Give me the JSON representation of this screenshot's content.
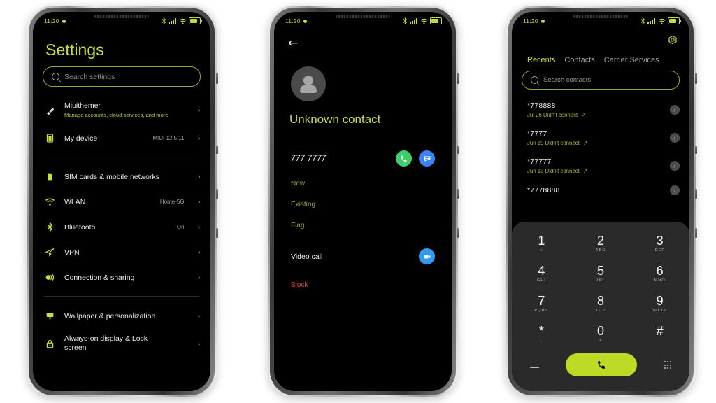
{
  "status_bar": {
    "time": "11:20",
    "icons": [
      "bluetooth-icon",
      "signal-icon",
      "wifi-icon",
      "battery-icon"
    ],
    "accent": "#c9d83a"
  },
  "settings_phone": {
    "title": "Settings",
    "search_placeholder": "Search settings",
    "groups": [
      {
        "items": [
          {
            "label": "Miuithemer",
            "subtitle": "Manage accounts, cloud services, and more",
            "value": "",
            "icon": "brush-icon"
          },
          {
            "label": "My device",
            "subtitle": "",
            "value": "MIUI 12.5.11",
            "icon": "device-icon"
          }
        ]
      },
      {
        "items": [
          {
            "label": "SIM cards & mobile networks",
            "subtitle": "",
            "value": "",
            "icon": "sim-card-icon"
          },
          {
            "label": "WLAN",
            "subtitle": "",
            "value": "Home-5G",
            "icon": "wifi-icon"
          },
          {
            "label": "Bluetooth",
            "subtitle": "",
            "value": "On",
            "icon": "bluetooth-icon"
          },
          {
            "label": "VPN",
            "subtitle": "",
            "value": "",
            "icon": "vpn-icon"
          },
          {
            "label": "Connection & sharing",
            "subtitle": "",
            "value": "",
            "icon": "connection-sharing-icon"
          }
        ]
      },
      {
        "items": [
          {
            "label": "Wallpaper & personalization",
            "subtitle": "",
            "value": "",
            "icon": "wallpaper-icon"
          },
          {
            "label": "Always-on display & Lock screen",
            "subtitle": "",
            "value": "",
            "icon": "lock-icon"
          }
        ]
      }
    ]
  },
  "contact_phone": {
    "back_icon": "back-arrow-icon",
    "avatar_icon": "person-avatar-icon",
    "name": "Unknown contact",
    "phone_number": "777 7777",
    "call_icon": "phone-call-icon",
    "message_icon": "message-icon",
    "actions": [
      "New",
      "Existing",
      "Flag"
    ],
    "video_call_label": "Video call",
    "video_icon": "video-camera-icon",
    "block_label": "Block",
    "colors": {
      "call": "#3ecf6a",
      "message": "#3b82f6",
      "video": "#2f9bf0",
      "block": "#e04b4b"
    }
  },
  "dialer_phone": {
    "settings_icon": "gear-icon",
    "tabs": [
      {
        "label": "Recents",
        "active": true
      },
      {
        "label": "Contacts",
        "active": false
      },
      {
        "label": "Carrier Services",
        "active": false
      }
    ],
    "search_placeholder": "Search contacts",
    "call_log": [
      {
        "number": "*778888",
        "detail": "Jul 26 Didn't connect",
        "direction_icon": "outgoing-call-icon"
      },
      {
        "number": "*7777",
        "detail": "Jun 19 Didn't connect",
        "direction_icon": "outgoing-call-icon"
      },
      {
        "number": "*77777",
        "detail": "Jun 13 Didn't connect",
        "direction_icon": "outgoing-call-icon"
      },
      {
        "number": "*7778888",
        "detail": "",
        "direction_icon": "outgoing-call-icon"
      }
    ],
    "keypad": [
      {
        "digit": "1",
        "sub": "∞"
      },
      {
        "digit": "2",
        "sub": "ABC"
      },
      {
        "digit": "3",
        "sub": "DEF"
      },
      {
        "digit": "4",
        "sub": "GHI"
      },
      {
        "digit": "5",
        "sub": "JKL"
      },
      {
        "digit": "6",
        "sub": "MNO"
      },
      {
        "digit": "7",
        "sub": "PQRS"
      },
      {
        "digit": "8",
        "sub": "TUV"
      },
      {
        "digit": "9",
        "sub": "WXYZ"
      },
      {
        "digit": "*",
        "sub": ","
      },
      {
        "digit": "0",
        "sub": "+"
      },
      {
        "digit": "#",
        "sub": ""
      }
    ],
    "menu_icon": "hamburger-menu-icon",
    "call_button_icon": "phone-call-icon",
    "keypad_toggle_icon": "dialpad-icon",
    "call_button_color": "#bddb24"
  }
}
